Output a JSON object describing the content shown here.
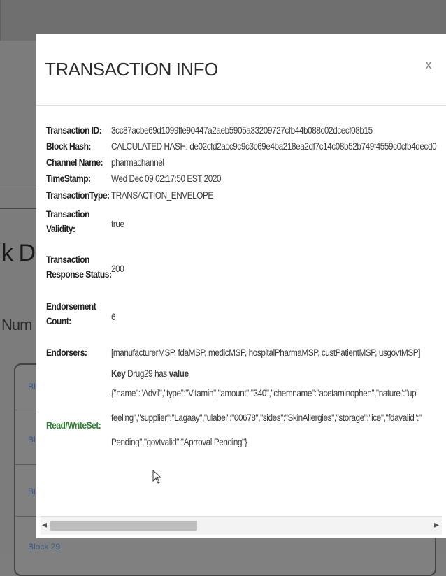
{
  "background": {
    "heading": "k De",
    "subheading": "Num",
    "rows": [
      "Bl",
      "Bl",
      "Bl",
      "Block 29"
    ]
  },
  "modal": {
    "title": "TRANSACTION INFO",
    "close_label": "x",
    "fields": [
      {
        "label": "Transaction ID:",
        "value": "3cc87acbe69d1099ffe90447a2aeb5905a33209727cfb44b088c02dcecf08b15"
      },
      {
        "label": "Block Hash:",
        "value": "CALCULATED HASH: de02cfd2acc9c9c3c69e4ba218ea2df7c14c08b52b749f4559c0cfb4decd0"
      },
      {
        "label": "Channel Name:",
        "value": "pharmachannel"
      },
      {
        "label": "TimeStamp:",
        "value": "Wed Dec 09 02:17:50 EST 2020"
      },
      {
        "label": "TransactionType:",
        "value": "TRANSACTION_ENVELOPE"
      },
      {
        "label_l1": "Transaction",
        "label_l2": "Validity:",
        "value": "true"
      },
      {
        "label_l1": "Transaction",
        "label_l2": "Response Status:",
        "value": "200"
      },
      {
        "label_l1": "Endorsement",
        "label_l2": "Count:",
        "value": "6"
      },
      {
        "label": "Endorsers:",
        "value": "[manufacturerMSP, fdaMSP, medicMSP, hospitalPharmaMSP, custPatientMSP, usgovtMSP]"
      }
    ],
    "rwset": {
      "label": "Read/WriteSet:",
      "key_word": "Key",
      "key_name": "Drug29",
      "has_word": "has",
      "value_word": "value",
      "line1": "{\"name\":\"Advil\",\"type\":\"Vitamin\",\"amount\":\"340\",\"chemname\":\"acetaminophen\",\"nature\":\"upl",
      "line2": "feeling\",\"supplier\":\"Lagaay\",\"ulabel\":\"00678\",\"sides\":\"SkinAllergies\",\"storage\":\"ice\",\"fdavalid\":\"",
      "line3": "Pending\",\"govtvalid\":\"Aprroval Pending\"}"
    },
    "scroll": {
      "left_arrow": "◂",
      "right_arrow": "▸"
    }
  }
}
